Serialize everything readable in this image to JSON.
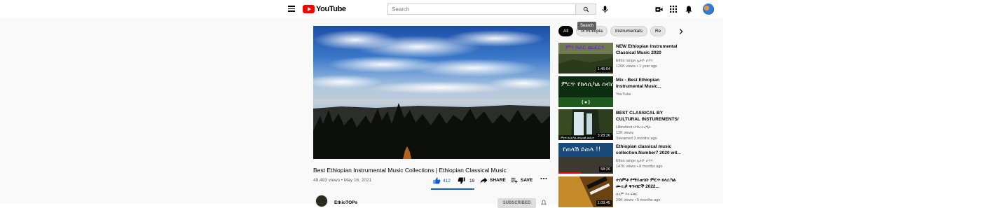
{
  "header": {
    "logo_text": "YouTube",
    "search_placeholder": "Search",
    "search_tooltip": "Search"
  },
  "video": {
    "title": "Best Ethiopian Instrumental Music Collections | Ethiopian Classical Music",
    "views": "49,493 views",
    "separator": "•",
    "date": "May 16, 2021",
    "likes": "412",
    "dislikes": "19",
    "share_label": "SHARE",
    "save_label": "SAVE",
    "like_ratio": 0.956
  },
  "channel": {
    "name": "EthioTOPs",
    "subscribe_label": "SUBSCRIBED"
  },
  "chips": [
    "All",
    "of Ethiopia",
    "Instrumentals",
    "Re"
  ],
  "recommendations": [
    {
      "title": "NEW Ethiopian Instrumental Classical Music 2020",
      "channel": "Ethio rango ኢትዮ ራንጎ",
      "meta": "126K views • 1 year ago",
      "duration": "1:46:04"
    },
    {
      "title": "Mix - Best Ethiopian Instrumental Music...",
      "channel": "YouTube",
      "meta": "",
      "duration": ""
    },
    {
      "title": "BEST CLASSICAL BY CULTURAL INSTUREMENTS/ምርጥ...",
      "channel": "Hibretireit ህብረትሪዒት",
      "meta": "12K views",
      "meta2": "Streamed 3 months ago",
      "duration": "3:28:26"
    },
    {
      "title": "Ethiopian classical music collection.Number7 2020 wit...",
      "channel": "Ethio rango ኢትዮ ራንጎ",
      "meta": "147K views • 8 months ago",
      "duration": "58:26"
    },
    {
      "title": "ተሰምቶ የማይጠገቡ ምርጥ ክላሲካል ሙዚቃ ቅንብሮች 2022...",
      "channel": "ሰላም እና ፍቅር",
      "meta": "29K views • 5 months ago",
      "duration": "1:09:45"
    }
  ],
  "thumb_text": {
    "rec1": "ምን ክራር ጨፈርን",
    "rec2": "ምርጥ የክላሲካል ስብስቦች",
    "rec3": "ምርጥ ክላሲካል በባህላዊ መሳሪያ",
    "rec4": "የጠላሽ ይጠላ !!"
  }
}
